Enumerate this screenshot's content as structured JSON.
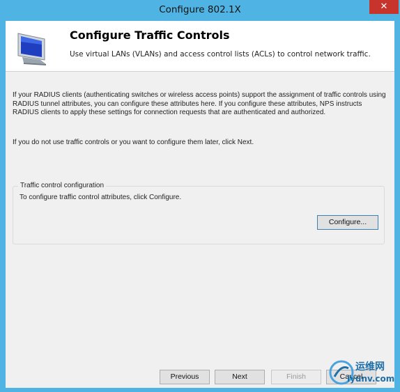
{
  "window": {
    "title": "Configure 802.1X",
    "close_glyph": "✕"
  },
  "header": {
    "icon": "monitor-icon",
    "title": "Configure Traffic Controls",
    "description": "Use virtual LANs (VLANs) and access control lists (ACLs) to control network traffic."
  },
  "body": {
    "paragraph1": "If your RADIUS clients (authenticating switches or wireless access points) support the assignment of traffic controls using RADIUS tunnel attributes, you can configure these attributes here. If you configure these attributes, NPS instructs RADIUS clients to apply these settings for connection requests that are authenticated and authorized.",
    "paragraph2": "If you do not use traffic controls or you want to configure them later, click Next."
  },
  "group": {
    "legend": "Traffic control configuration",
    "description": "To configure traffic control attributes, click Configure.",
    "configure_label": "Configure..."
  },
  "footer": {
    "previous_label": "Previous",
    "next_label": "Next",
    "finish_label": "Finish",
    "cancel_label": "Cancel"
  },
  "watermark": {
    "text": "运维网",
    "sub": "iyunv.com"
  },
  "colors": {
    "titlebar": "#4fb4e3",
    "close": "#c7342c",
    "dialog_bg": "#f0f0f0"
  }
}
